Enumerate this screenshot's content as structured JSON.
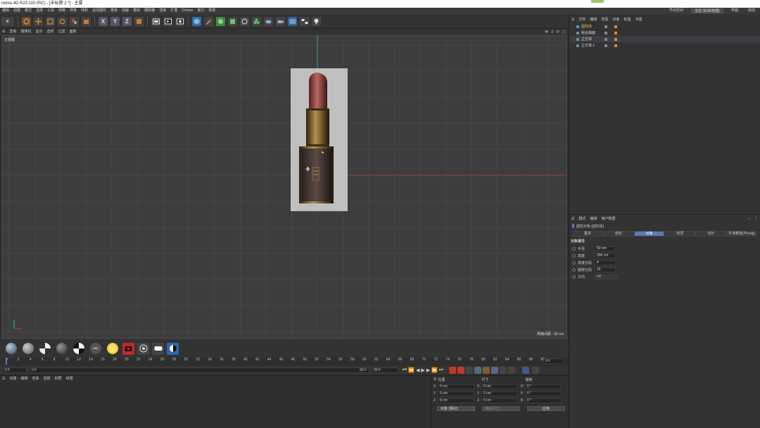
{
  "window": {
    "title": "nema 4D R23.110 (RC) - [未标题 2 *] - 主要"
  },
  "menubar": {
    "items": [
      "编辑",
      "创建",
      "模式",
      "选择",
      "工具",
      "网格",
      "样条",
      "体积",
      "运动图形",
      "角色",
      "动画",
      "模拟",
      "跟踪器",
      "渲染",
      "扩展",
      "Octane",
      "窗口",
      "帮助"
    ],
    "right": {
      "layout_label": "节点空间",
      "layout_value": "当前 (标准/物理)",
      "interface_label": "界面",
      "startup_label": "启动"
    }
  },
  "toolbar": {
    "axes": [
      "X",
      "Y",
      "Z"
    ]
  },
  "viewport": {
    "menu": [
      "查看",
      "摄像机",
      "显示",
      "选项",
      "过滤",
      "面板"
    ],
    "label": "正视图",
    "grid_spacing": "网格间距 : 50 cm",
    "colors": {
      "grid": "#4a4a4a",
      "x_axis": "#c0392b",
      "y_axis": "#2ecc71"
    }
  },
  "timeline": {
    "ticks": [
      "0",
      "2",
      "4",
      "6",
      "8",
      "10",
      "12",
      "14",
      "16",
      "18",
      "20",
      "22",
      "24",
      "26",
      "28",
      "30",
      "32",
      "34",
      "36",
      "38",
      "40",
      "42",
      "44",
      "46",
      "48",
      "50",
      "52",
      "54",
      "56",
      "58",
      "60",
      "62",
      "64",
      "66",
      "68",
      "70",
      "72",
      "74",
      "76",
      "78",
      "80",
      "82",
      "84",
      "86",
      "88",
      "90"
    ],
    "current_frame": "0 F",
    "start": "0 F",
    "start2": "0 F",
    "end": "90 F",
    "end2": "90 F",
    "right_frame": "0 F"
  },
  "material_manager": {
    "menu": [
      "创建",
      "编辑",
      "查看",
      "选择",
      "材质",
      "纹理"
    ]
  },
  "coordinates": {
    "headers": [
      "位置",
      "尺寸",
      "旋转"
    ],
    "rows": [
      {
        "p_axis": "X",
        "p": "0 cm",
        "s_axis": "X",
        "s": "0 cm",
        "r_axis": "H",
        "r": "0 °"
      },
      {
        "p_axis": "Y",
        "p": "0 cm",
        "s_axis": "Y",
        "s": "0 cm",
        "r_axis": "P",
        "r": "0 °"
      },
      {
        "p_axis": "Z",
        "p": "0 cm",
        "s_axis": "Z",
        "s": "0 cm",
        "r_axis": "B",
        "r": "0 °"
      }
    ],
    "mode": "对象 (相对)",
    "size_mode": "绝对尺寸",
    "apply": "应用"
  },
  "object_manager": {
    "menu": [
      "文件",
      "编辑",
      "查看",
      "对象",
      "标签",
      "书签"
    ],
    "objects": [
      {
        "name": "圆柱体",
        "color": "#e8c04a"
      },
      {
        "name": "组合曲面",
        "color": "#dddddd"
      },
      {
        "name": "立方体",
        "color": "#dddddd"
      },
      {
        "name": "立方体.1",
        "color": "#dddddd"
      }
    ]
  },
  "attribute_manager": {
    "menu": [
      "模式",
      "编辑",
      "用户数据"
    ],
    "object_title": "圆柱对象 [圆柱体]",
    "tabs": [
      "基本",
      "坐标",
      "对象",
      "封顶",
      "切片",
      "平滑着色(Phong)"
    ],
    "active_tab": 2,
    "section": "对象属性",
    "props": [
      {
        "label": "半径",
        "value": "50 cm"
      },
      {
        "label": "高度",
        "value": "200 cm"
      },
      {
        "label": "高度分段",
        "value": "4"
      },
      {
        "label": "旋转分段",
        "value": "16"
      },
      {
        "label": "方向",
        "value": "+Y"
      }
    ]
  }
}
